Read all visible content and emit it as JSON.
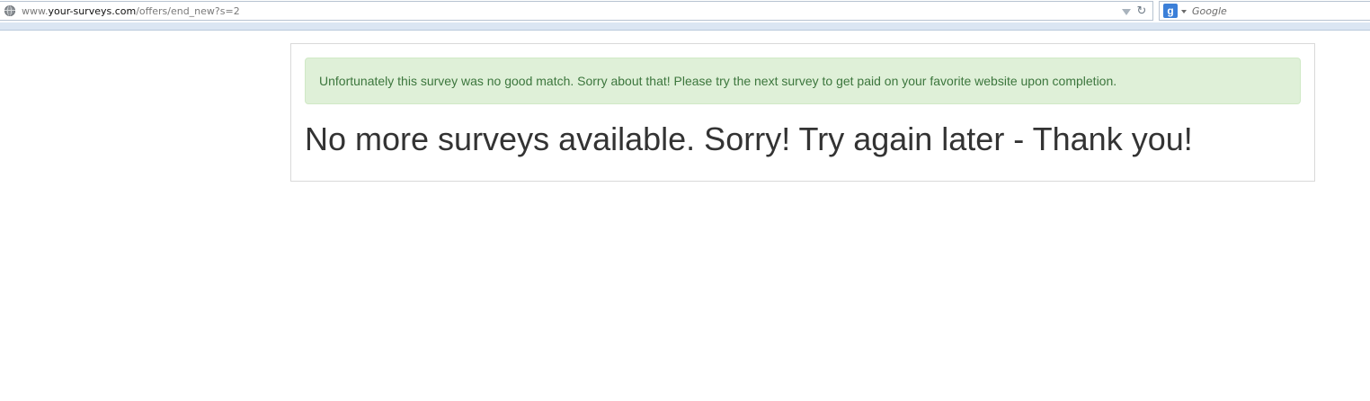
{
  "browser": {
    "url_prefix": "www.",
    "url_domain": "your-surveys.com",
    "url_path": "/offers/end_new?s=2",
    "search_engine_letter": "g",
    "search_placeholder": "Google",
    "reload_glyph": "↻"
  },
  "page": {
    "alert_message": "Unfortunately this survey was no good match. Sorry about that! Please try the next survey to get paid on your favorite website upon completion.",
    "headline": "No more surveys available. Sorry! Try again later - Thank you!"
  },
  "colors": {
    "alert_background": "#dff0d8",
    "alert_text": "#3c763d",
    "headline_text": "#333333"
  },
  "icons": {
    "site": "globe-icon",
    "url_history": "dropdown-arrow-icon",
    "reload": "reload-icon",
    "search_provider": "google-icon"
  }
}
